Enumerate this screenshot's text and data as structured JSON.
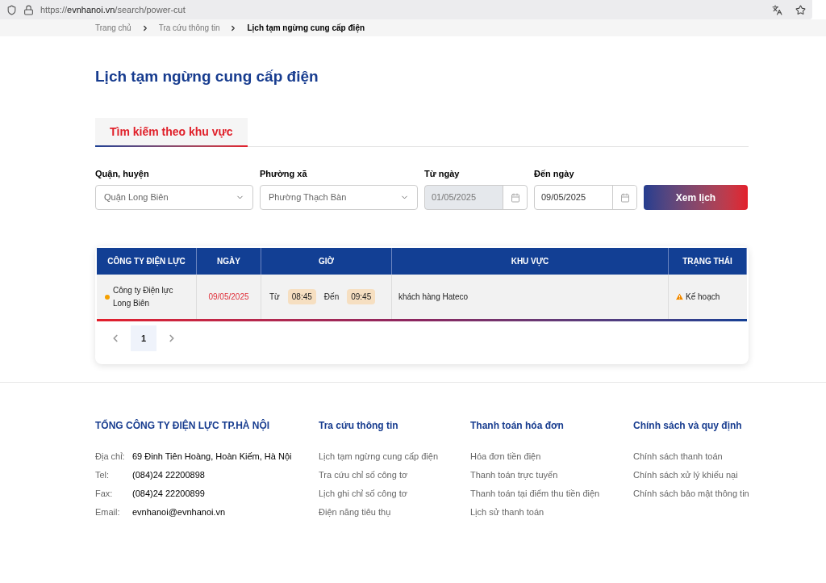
{
  "browser": {
    "url_prefix": "https://",
    "url_host": "evnhanoi.vn",
    "url_path": "/search/power-cut"
  },
  "breadcrumb": [
    "Trang chủ",
    "Tra cứu thông tin",
    "Lịch tạm ngừng cung cấp điện"
  ],
  "title": "Lịch tạm ngừng cung cấp điện",
  "tabs": [
    {
      "label": "Tìm kiếm theo khu vực",
      "selected": true
    }
  ],
  "filters": [
    {
      "kind": "select",
      "label": "Quận, huyện",
      "value": "Quận Long Biên"
    },
    {
      "kind": "select",
      "label": "Phường xã",
      "value": "Phường Thạch Bàn"
    },
    {
      "kind": "date",
      "label": "Từ ngày",
      "value": "01/05/2025",
      "disabled": true
    },
    {
      "kind": "date",
      "label": "Đến ngày",
      "value": "09/05/2025",
      "disabled": false
    }
  ],
  "search_button": "Xem lịch",
  "table": {
    "columns": [
      "CÔNG TY ĐIỆN LỰC",
      "NGÀY",
      "GIỜ",
      "KHU VỰC",
      "TRẠNG THÁI"
    ],
    "rows": [
      {
        "company": "Công ty Điện lực Long Biên",
        "color": "#f5a000",
        "date": "09/05/2025",
        "from_label": "Từ",
        "from": "08:45",
        "to_label": "Đến",
        "to": "09:45",
        "area": "khách hàng Hateco",
        "status": "Kế hoạch"
      }
    ]
  },
  "pagination": {
    "pages": [
      {
        "label": "1",
        "selected": true
      }
    ]
  },
  "footer": {
    "company": {
      "title": "TỔNG CÔNG TY ĐIỆN LỰC TP.HÀ NỘI",
      "rows": [
        {
          "label": "Địa chỉ:",
          "value": "69 Đinh Tiên Hoàng, Hoàn Kiếm, Hà Nội"
        },
        {
          "label": "Tel:",
          "value": "(084)24 22200898"
        },
        {
          "label": "Fax:",
          "value": "(084)24 22200899"
        },
        {
          "label": "Email:",
          "value": "evnhanoi@evnhanoi.vn"
        }
      ]
    },
    "columns": [
      {
        "title": "Tra cứu thông tin",
        "links": [
          "Lịch tạm ngừng cung cấp điện",
          "Tra cứu chỉ số công tơ",
          "Lịch ghi chỉ số công tơ",
          "Điện năng tiêu thụ"
        ]
      },
      {
        "title": "Thanh toán hóa đơn",
        "links": [
          "Hóa đơn tiền điện",
          "Thanh toán trực tuyến",
          "Thanh toán tại điểm thu tiền điện",
          "Lịch sử thanh toán"
        ]
      },
      {
        "title": "Chính sách và quy định",
        "links": [
          "Chính sách thanh toán",
          "Chính sách xử lý khiếu nại",
          "Chính sách bảo mật thông tin"
        ]
      }
    ]
  }
}
